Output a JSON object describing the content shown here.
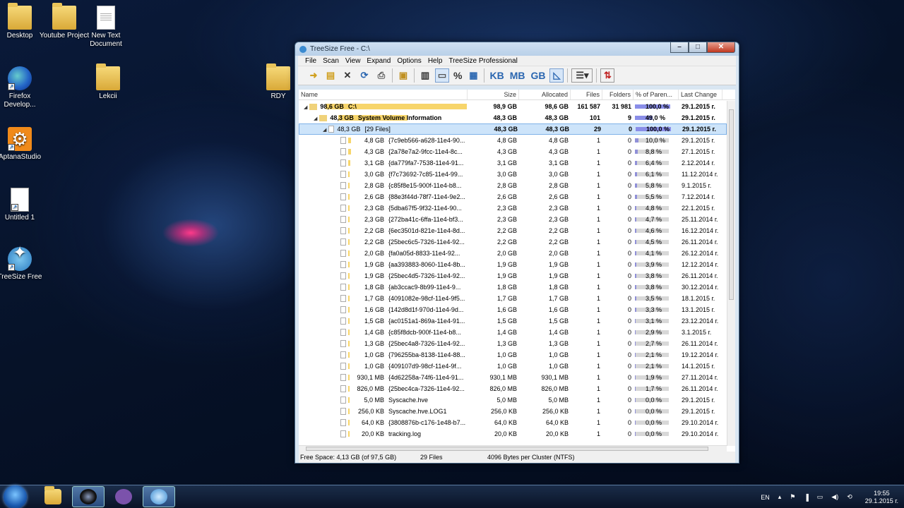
{
  "desktop": {
    "icons": [
      {
        "label": "Desktop",
        "type": "folder"
      },
      {
        "label": "Youtube Project",
        "type": "folder"
      },
      {
        "label": "New Text Document",
        "type": "doc"
      },
      {
        "label": "Firefox Develop...",
        "type": "firefox"
      },
      {
        "label": "Lekcii",
        "type": "folder"
      },
      {
        "label": "RDY",
        "type": "folder"
      },
      {
        "label": "AptanaStudio",
        "type": "app"
      },
      {
        "label": "Untitled 1",
        "type": "image"
      },
      {
        "label": "TreeSize Free",
        "type": "app"
      }
    ]
  },
  "window": {
    "title": "TreeSize Free - C:\\",
    "menu": [
      "File",
      "Scan",
      "View",
      "Expand",
      "Options",
      "Help",
      "TreeSize Professional"
    ],
    "toolbar": {
      "kb": "KB",
      "mb": "MB",
      "gb": "GB",
      "pct": "%"
    },
    "columns": {
      "name": "Name",
      "size": "Size",
      "allocated": "Allocated",
      "files": "Files",
      "folders": "Folders",
      "pct": "% of Paren...",
      "last": "Last Change"
    },
    "rows": [
      {
        "level": 0,
        "kind": "drive",
        "bar_size": "98,6 GB",
        "label": "C:\\",
        "size": "98,9 GB",
        "alloc": "98,6 GB",
        "files": "161 587",
        "folders": "31 981",
        "pct": "100,0 %",
        "pct_value": 100,
        "date": "29.1.2015 г.",
        "bold": true,
        "bar_frac": 1.0
      },
      {
        "level": 1,
        "kind": "folder",
        "bar_size": "48,3 GB",
        "label": "System Volume Information",
        "size": "48,3 GB",
        "alloc": "48,3 GB",
        "files": "101",
        "folders": "9",
        "pct": "49,0 %",
        "pct_value": 49,
        "date": "29.1.2015 г.",
        "bold": true,
        "bar_frac": 0.49
      },
      {
        "level": 2,
        "kind": "files",
        "bar_size": "48,3 GB",
        "label": "[29 Files]",
        "size": "48,3 GB",
        "alloc": "48,3 GB",
        "files": "29",
        "folders": "0",
        "pct": "100,0 %",
        "pct_value": 100,
        "date": "29.1.2015 г.",
        "bold": false,
        "selected": true,
        "bar_frac": 0
      },
      {
        "level": 3,
        "bar_size": "4,8 GB",
        "label": "{7c9eb566-a628-11e4-90...",
        "size": "4,8 GB",
        "alloc": "4,8 GB",
        "files": "1",
        "folders": "0",
        "pct": "10,0 %",
        "pct_value": 10,
        "date": "29.1.2015 г."
      },
      {
        "level": 3,
        "bar_size": "4,3 GB",
        "label": "{2a78e7a2-9fcc-11e4-8c...",
        "size": "4,3 GB",
        "alloc": "4,3 GB",
        "files": "1",
        "folders": "0",
        "pct": "8,8 %",
        "pct_value": 8.8,
        "date": "27.1.2015 г."
      },
      {
        "level": 3,
        "bar_size": "3,1 GB",
        "label": "{da779fa7-7538-11e4-91...",
        "size": "3,1 GB",
        "alloc": "3,1 GB",
        "files": "1",
        "folders": "0",
        "pct": "6,4 %",
        "pct_value": 6.4,
        "date": "2.12.2014 г."
      },
      {
        "level": 3,
        "bar_size": "3,0 GB",
        "label": "{f7c73692-7c85-11e4-99...",
        "size": "3,0 GB",
        "alloc": "3,0 GB",
        "files": "1",
        "folders": "0",
        "pct": "6,1 %",
        "pct_value": 6.1,
        "date": "11.12.2014 г."
      },
      {
        "level": 3,
        "bar_size": "2,8 GB",
        "label": "{c85f8e15-900f-11e4-b8...",
        "size": "2,8 GB",
        "alloc": "2,8 GB",
        "files": "1",
        "folders": "0",
        "pct": "5,8 %",
        "pct_value": 5.8,
        "date": "9.1.2015 г."
      },
      {
        "level": 3,
        "bar_size": "2,6 GB",
        "label": "{88e3f44d-78f7-11e4-9e2...",
        "size": "2,6 GB",
        "alloc": "2,6 GB",
        "files": "1",
        "folders": "0",
        "pct": "5,5 %",
        "pct_value": 5.5,
        "date": "7.12.2014 г."
      },
      {
        "level": 3,
        "bar_size": "2,3 GB",
        "label": "{5dba67f5-9f32-11e4-90...",
        "size": "2,3 GB",
        "alloc": "2,3 GB",
        "files": "1",
        "folders": "0",
        "pct": "4,8 %",
        "pct_value": 4.8,
        "date": "22.1.2015 г."
      },
      {
        "level": 3,
        "bar_size": "2,3 GB",
        "label": "{272ba41c-6ffa-11e4-bf3...",
        "size": "2,3 GB",
        "alloc": "2,3 GB",
        "files": "1",
        "folders": "0",
        "pct": "4,7 %",
        "pct_value": 4.7,
        "date": "25.11.2014 г."
      },
      {
        "level": 3,
        "bar_size": "2,2 GB",
        "label": "{6ec3501d-821e-11e4-8d...",
        "size": "2,2 GB",
        "alloc": "2,2 GB",
        "files": "1",
        "folders": "0",
        "pct": "4,6 %",
        "pct_value": 4.6,
        "date": "16.12.2014 г."
      },
      {
        "level": 3,
        "bar_size": "2,2 GB",
        "label": "{25bec6c5-7326-11e4-92...",
        "size": "2,2 GB",
        "alloc": "2,2 GB",
        "files": "1",
        "folders": "0",
        "pct": "4,5 %",
        "pct_value": 4.5,
        "date": "26.11.2014 г."
      },
      {
        "level": 3,
        "bar_size": "2,0 GB",
        "label": "{fa0a05d-8833-11e4-92...",
        "size": "2,0 GB",
        "alloc": "2,0 GB",
        "files": "1",
        "folders": "0",
        "pct": "4,1 %",
        "pct_value": 4.1,
        "date": "26.12.2014 г."
      },
      {
        "level": 3,
        "bar_size": "1,9 GB",
        "label": "{aa393883-8060-11e4-8b...",
        "size": "1,9 GB",
        "alloc": "1,9 GB",
        "files": "1",
        "folders": "0",
        "pct": "3,9 %",
        "pct_value": 3.9,
        "date": "12.12.2014 г."
      },
      {
        "level": 3,
        "bar_size": "1,9 GB",
        "label": "{25bec4d5-7326-11e4-92...",
        "size": "1,9 GB",
        "alloc": "1,9 GB",
        "files": "1",
        "folders": "0",
        "pct": "3,8 %",
        "pct_value": 3.8,
        "date": "26.11.2014 г."
      },
      {
        "level": 3,
        "bar_size": "1,8 GB",
        "label": "{ab3ccac9-8b99-11e4-9...",
        "size": "1,8 GB",
        "alloc": "1,8 GB",
        "files": "1",
        "folders": "0",
        "pct": "3,8 %",
        "pct_value": 3.8,
        "date": "30.12.2014 г."
      },
      {
        "level": 3,
        "bar_size": "1,7 GB",
        "label": "{4091082e-98cf-11e4-9f5...",
        "size": "1,7 GB",
        "alloc": "1,7 GB",
        "files": "1",
        "folders": "0",
        "pct": "3,5 %",
        "pct_value": 3.5,
        "date": "18.1.2015 г."
      },
      {
        "level": 3,
        "bar_size": "1,6 GB",
        "label": "{142d8d1f-970d-11e4-9d...",
        "size": "1,6 GB",
        "alloc": "1,6 GB",
        "files": "1",
        "folders": "0",
        "pct": "3,3 %",
        "pct_value": 3.3,
        "date": "13.1.2015 г."
      },
      {
        "level": 3,
        "bar_size": "1,5 GB",
        "label": "{ac0151a1-869a-11e4-91...",
        "size": "1,5 GB",
        "alloc": "1,5 GB",
        "files": "1",
        "folders": "0",
        "pct": "3,1 %",
        "pct_value": 3.1,
        "date": "23.12.2014 г."
      },
      {
        "level": 3,
        "bar_size": "1,4 GB",
        "label": "{c85f8dcb-900f-11e4-b8...",
        "size": "1,4 GB",
        "alloc": "1,4 GB",
        "files": "1",
        "folders": "0",
        "pct": "2,9 %",
        "pct_value": 2.9,
        "date": "3.1.2015 г."
      },
      {
        "level": 3,
        "bar_size": "1,3 GB",
        "label": "{25bec4a8-7326-11e4-92...",
        "size": "1,3 GB",
        "alloc": "1,3 GB",
        "files": "1",
        "folders": "0",
        "pct": "2,7 %",
        "pct_value": 2.7,
        "date": "26.11.2014 г."
      },
      {
        "level": 3,
        "bar_size": "1,0 GB",
        "label": "{796255ba-8138-11e4-88...",
        "size": "1,0 GB",
        "alloc": "1,0 GB",
        "files": "1",
        "folders": "0",
        "pct": "2,1 %",
        "pct_value": 2.1,
        "date": "19.12.2014 г."
      },
      {
        "level": 3,
        "bar_size": "1,0 GB",
        "label": "{409107d9-98cf-11e4-9f...",
        "size": "1,0 GB",
        "alloc": "1,0 GB",
        "files": "1",
        "folders": "0",
        "pct": "2,1 %",
        "pct_value": 2.1,
        "date": "14.1.2015 г."
      },
      {
        "level": 3,
        "bar_size": "930,1 MB",
        "label": "{4d62258a-74f6-11e4-91...",
        "size": "930,1 MB",
        "alloc": "930,1 MB",
        "files": "1",
        "folders": "0",
        "pct": "1,9 %",
        "pct_value": 1.9,
        "date": "27.11.2014 г."
      },
      {
        "level": 3,
        "bar_size": "826,0 MB",
        "label": "{25bec4ca-7326-11e4-92...",
        "size": "826,0 MB",
        "alloc": "826,0 MB",
        "files": "1",
        "folders": "0",
        "pct": "1,7 %",
        "pct_value": 1.7,
        "date": "26.11.2014 г."
      },
      {
        "level": 3,
        "bar_size": "5,0 MB",
        "label": "Syscache.hve",
        "size": "5,0 MB",
        "alloc": "5,0 MB",
        "files": "1",
        "folders": "0",
        "pct": "0,0 %",
        "pct_value": 0,
        "date": "29.1.2015 г."
      },
      {
        "level": 3,
        "bar_size": "256,0 KB",
        "label": "Syscache.hve.LOG1",
        "size": "256,0 KB",
        "alloc": "256,0 KB",
        "files": "1",
        "folders": "0",
        "pct": "0,0 %",
        "pct_value": 0,
        "date": "29.1.2015 г."
      },
      {
        "level": 3,
        "bar_size": "64,0 KB",
        "label": "{3808876b-c176-1e48-b7...",
        "size": "64,0 KB",
        "alloc": "64,0 KB",
        "files": "1",
        "folders": "0",
        "pct": "0,0 %",
        "pct_value": 0,
        "date": "29.10.2014 г."
      },
      {
        "level": 3,
        "bar_size": "20,0 KB",
        "label": "tracking.log",
        "size": "20,0 KB",
        "alloc": "20,0 KB",
        "files": "1",
        "folders": "0",
        "pct": "0,0 %",
        "pct_value": 0,
        "date": "29.10.2014 г."
      }
    ],
    "status": {
      "free": "Free Space: 4,13 GB  (of 97,5 GB)",
      "files": "29  Files",
      "cluster": "4096 Bytes per Cluster (NTFS)"
    }
  },
  "taskbar": {
    "lang": "EN",
    "time": "19:55",
    "date": "29.1.2015 г."
  }
}
